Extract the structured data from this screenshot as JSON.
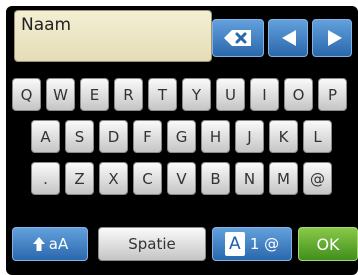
{
  "input": {
    "value": "Naam"
  },
  "keys": {
    "row1": [
      "Q",
      "W",
      "E",
      "R",
      "T",
      "Y",
      "U",
      "I",
      "O",
      "P"
    ],
    "row2": [
      "A",
      "S",
      "D",
      "F",
      "G",
      "H",
      "J",
      "K",
      "L"
    ],
    "row3": [
      ".",
      "Z",
      "X",
      "C",
      "V",
      "B",
      "N",
      "M",
      "@"
    ]
  },
  "bottom": {
    "shift_label": "aA",
    "space_label": "Spatie",
    "mode_selected": "A",
    "mode_rest": "1 @",
    "ok_label": "OK"
  },
  "icons": {
    "backspace": "backspace-icon",
    "left": "arrow-left-icon",
    "right": "arrow-right-icon",
    "shift": "shift-arrow-icon"
  },
  "colors": {
    "input_bg": "#efe9c8",
    "blue": "#2a68ad",
    "green": "#3f8f1d"
  }
}
